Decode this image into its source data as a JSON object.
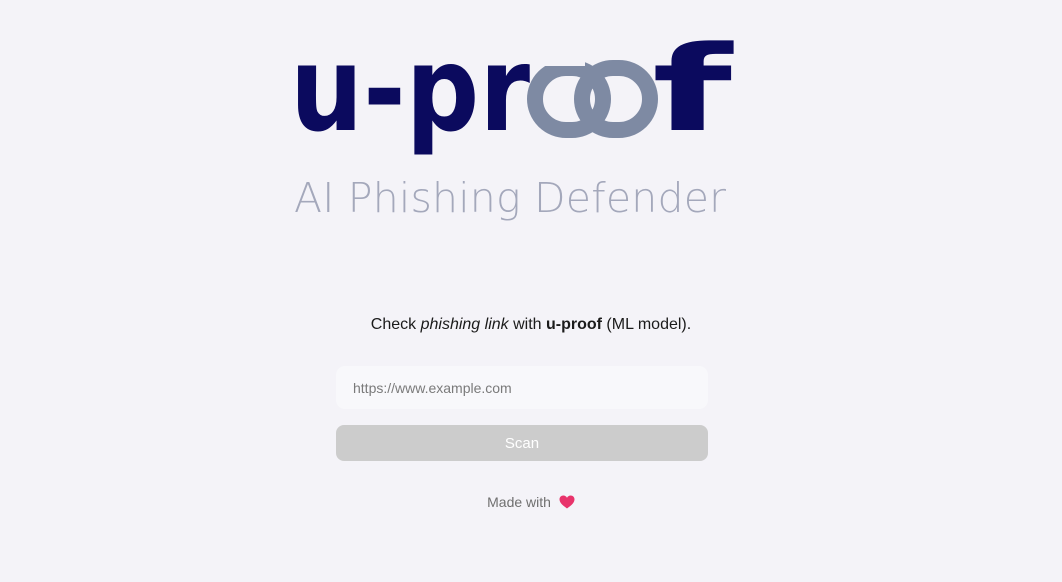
{
  "logo": {
    "part1": "u-pr",
    "part2": "f",
    "chain_alt": "oo",
    "colors": {
      "navy": "#0b0a5e",
      "chain": "#7e8aa3"
    }
  },
  "tagline": "AI Phishing Defender",
  "intro": {
    "before": "Check ",
    "emphasis": "phishing link",
    "middle": " with ",
    "brand": "u-proof",
    "after": " (ML model)."
  },
  "url_input": {
    "placeholder": "https://www.example.com",
    "value": ""
  },
  "scan_button": {
    "label": "Scan"
  },
  "footer": {
    "text": "Made with",
    "icon": "heart-icon",
    "icon_color": "#e8336b"
  },
  "colors": {
    "background": "#f4f3f8",
    "tagline": "#a4a8bb",
    "button_disabled": "#cccccc",
    "input_bg": "#f8f8fb"
  }
}
